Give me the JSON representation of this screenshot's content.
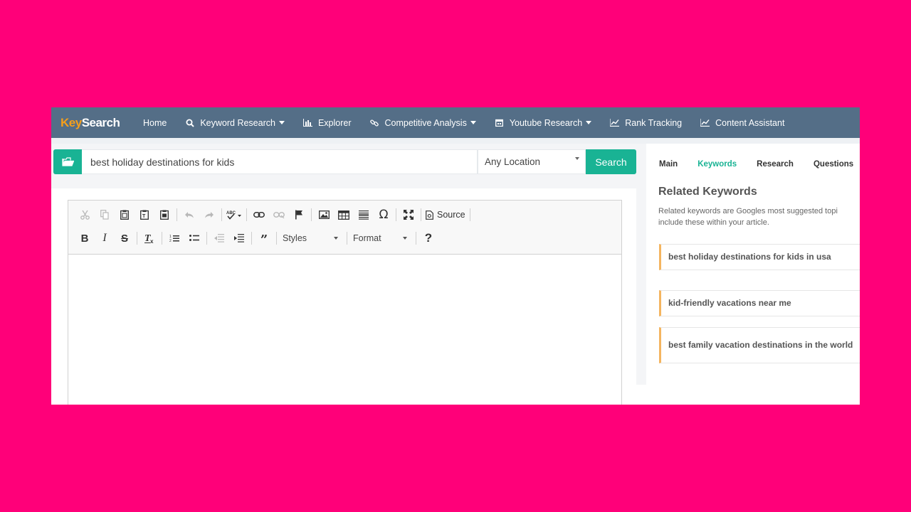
{
  "brand": {
    "logo_key": "Key",
    "logo_search": "Search"
  },
  "nav": [
    {
      "label": "Home",
      "icon": "none",
      "caret": false
    },
    {
      "label": "Keyword Research",
      "icon": "search-icon",
      "caret": true
    },
    {
      "label": "Explorer",
      "icon": "bar-chart-icon",
      "caret": false
    },
    {
      "label": "Competitive Analysis",
      "icon": "link-icon",
      "caret": true
    },
    {
      "label": "Youtube Research",
      "icon": "calendar-icon",
      "caret": true
    },
    {
      "label": "Rank Tracking",
      "icon": "line-chart-icon",
      "caret": false
    },
    {
      "label": "Content Assistant",
      "icon": "line-chart-icon",
      "caret": false
    }
  ],
  "search": {
    "query": "best holiday destinations for kids",
    "location": "Any Location",
    "button_label": "Search"
  },
  "editor": {
    "source_label": "Source",
    "styles_label": "Styles",
    "format_label": "Format",
    "help_label": "?"
  },
  "right_panel": {
    "tabs": [
      "Main",
      "Keywords",
      "Research",
      "Questions"
    ],
    "active_tab": "Keywords",
    "title": "Related Keywords",
    "description_line1": "Related keywords are Googles most suggested topi",
    "description_line2": "include these within your article.",
    "keywords": [
      "best holiday destinations for kids in usa",
      "kid-friendly vacations near me",
      "best family vacation destinations in the world"
    ]
  },
  "colors": {
    "background": "#ff0079",
    "navbar": "#546e87",
    "accent": "#19b394",
    "keyword_border": "#f4b560",
    "logo_orange": "#f59f1b"
  }
}
